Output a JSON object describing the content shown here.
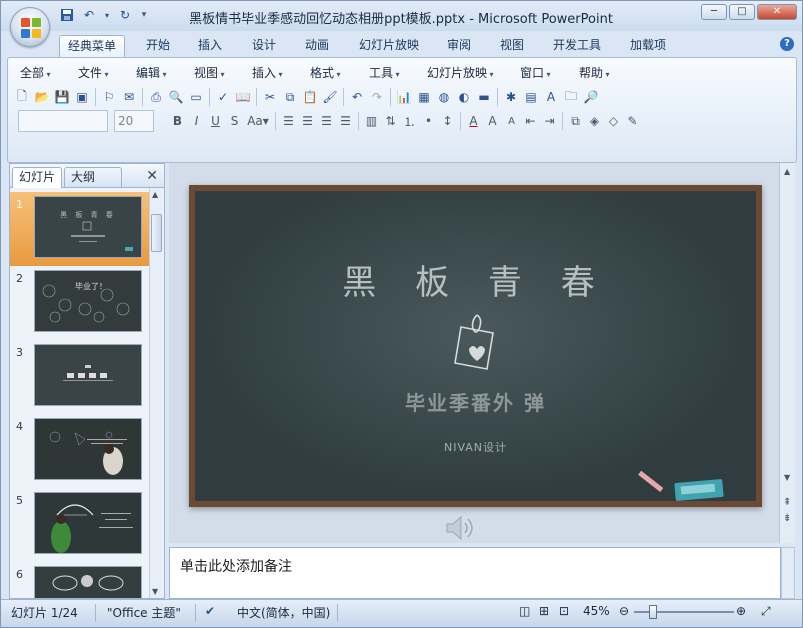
{
  "window": {
    "title": "黑板情书毕业季感动回忆动态相册ppt模板.pptx - Microsoft PowerPoint",
    "controls": [
      "minimize-icon",
      "maximize-icon",
      "close-icon"
    ]
  },
  "ribbon_tabs": [
    "经典菜单",
    "开始",
    "插入",
    "设计",
    "动画",
    "幻灯片放映",
    "审阅",
    "视图",
    "开发工具",
    "加载项"
  ],
  "active_tab": "经典菜单",
  "menus": [
    "全部",
    "文件",
    "编辑",
    "视图",
    "插入",
    "格式",
    "工具",
    "幻灯片放映",
    "窗口",
    "帮助"
  ],
  "font": {
    "name_placeholder": "",
    "size": "20"
  },
  "left_panel": {
    "tabs": [
      "幻灯片",
      "大纲"
    ],
    "active_tab": "幻灯片",
    "slides": [
      {
        "number": "1",
        "selected": true
      },
      {
        "number": "2",
        "caption": "毕业了！"
      },
      {
        "number": "3"
      },
      {
        "number": "4"
      },
      {
        "number": "5"
      },
      {
        "number": "6"
      }
    ]
  },
  "slide": {
    "title": "黑 板 青 春",
    "subtitle": "毕业季番外 弹",
    "credit": "NIVAN设计"
  },
  "notes": {
    "placeholder": "单击此处添加备注"
  },
  "status_bar": {
    "slide_indicator": "幻灯片 1/24",
    "theme": "\"Office 主题\"",
    "language": "中文(简体，中国)",
    "zoom": "45%"
  },
  "colors": {
    "ribbon_bg": "#dde8f5",
    "selected_thumb": "#e99a3f",
    "chalkboard": "#2f3d40",
    "frame": "#6a4a33"
  }
}
